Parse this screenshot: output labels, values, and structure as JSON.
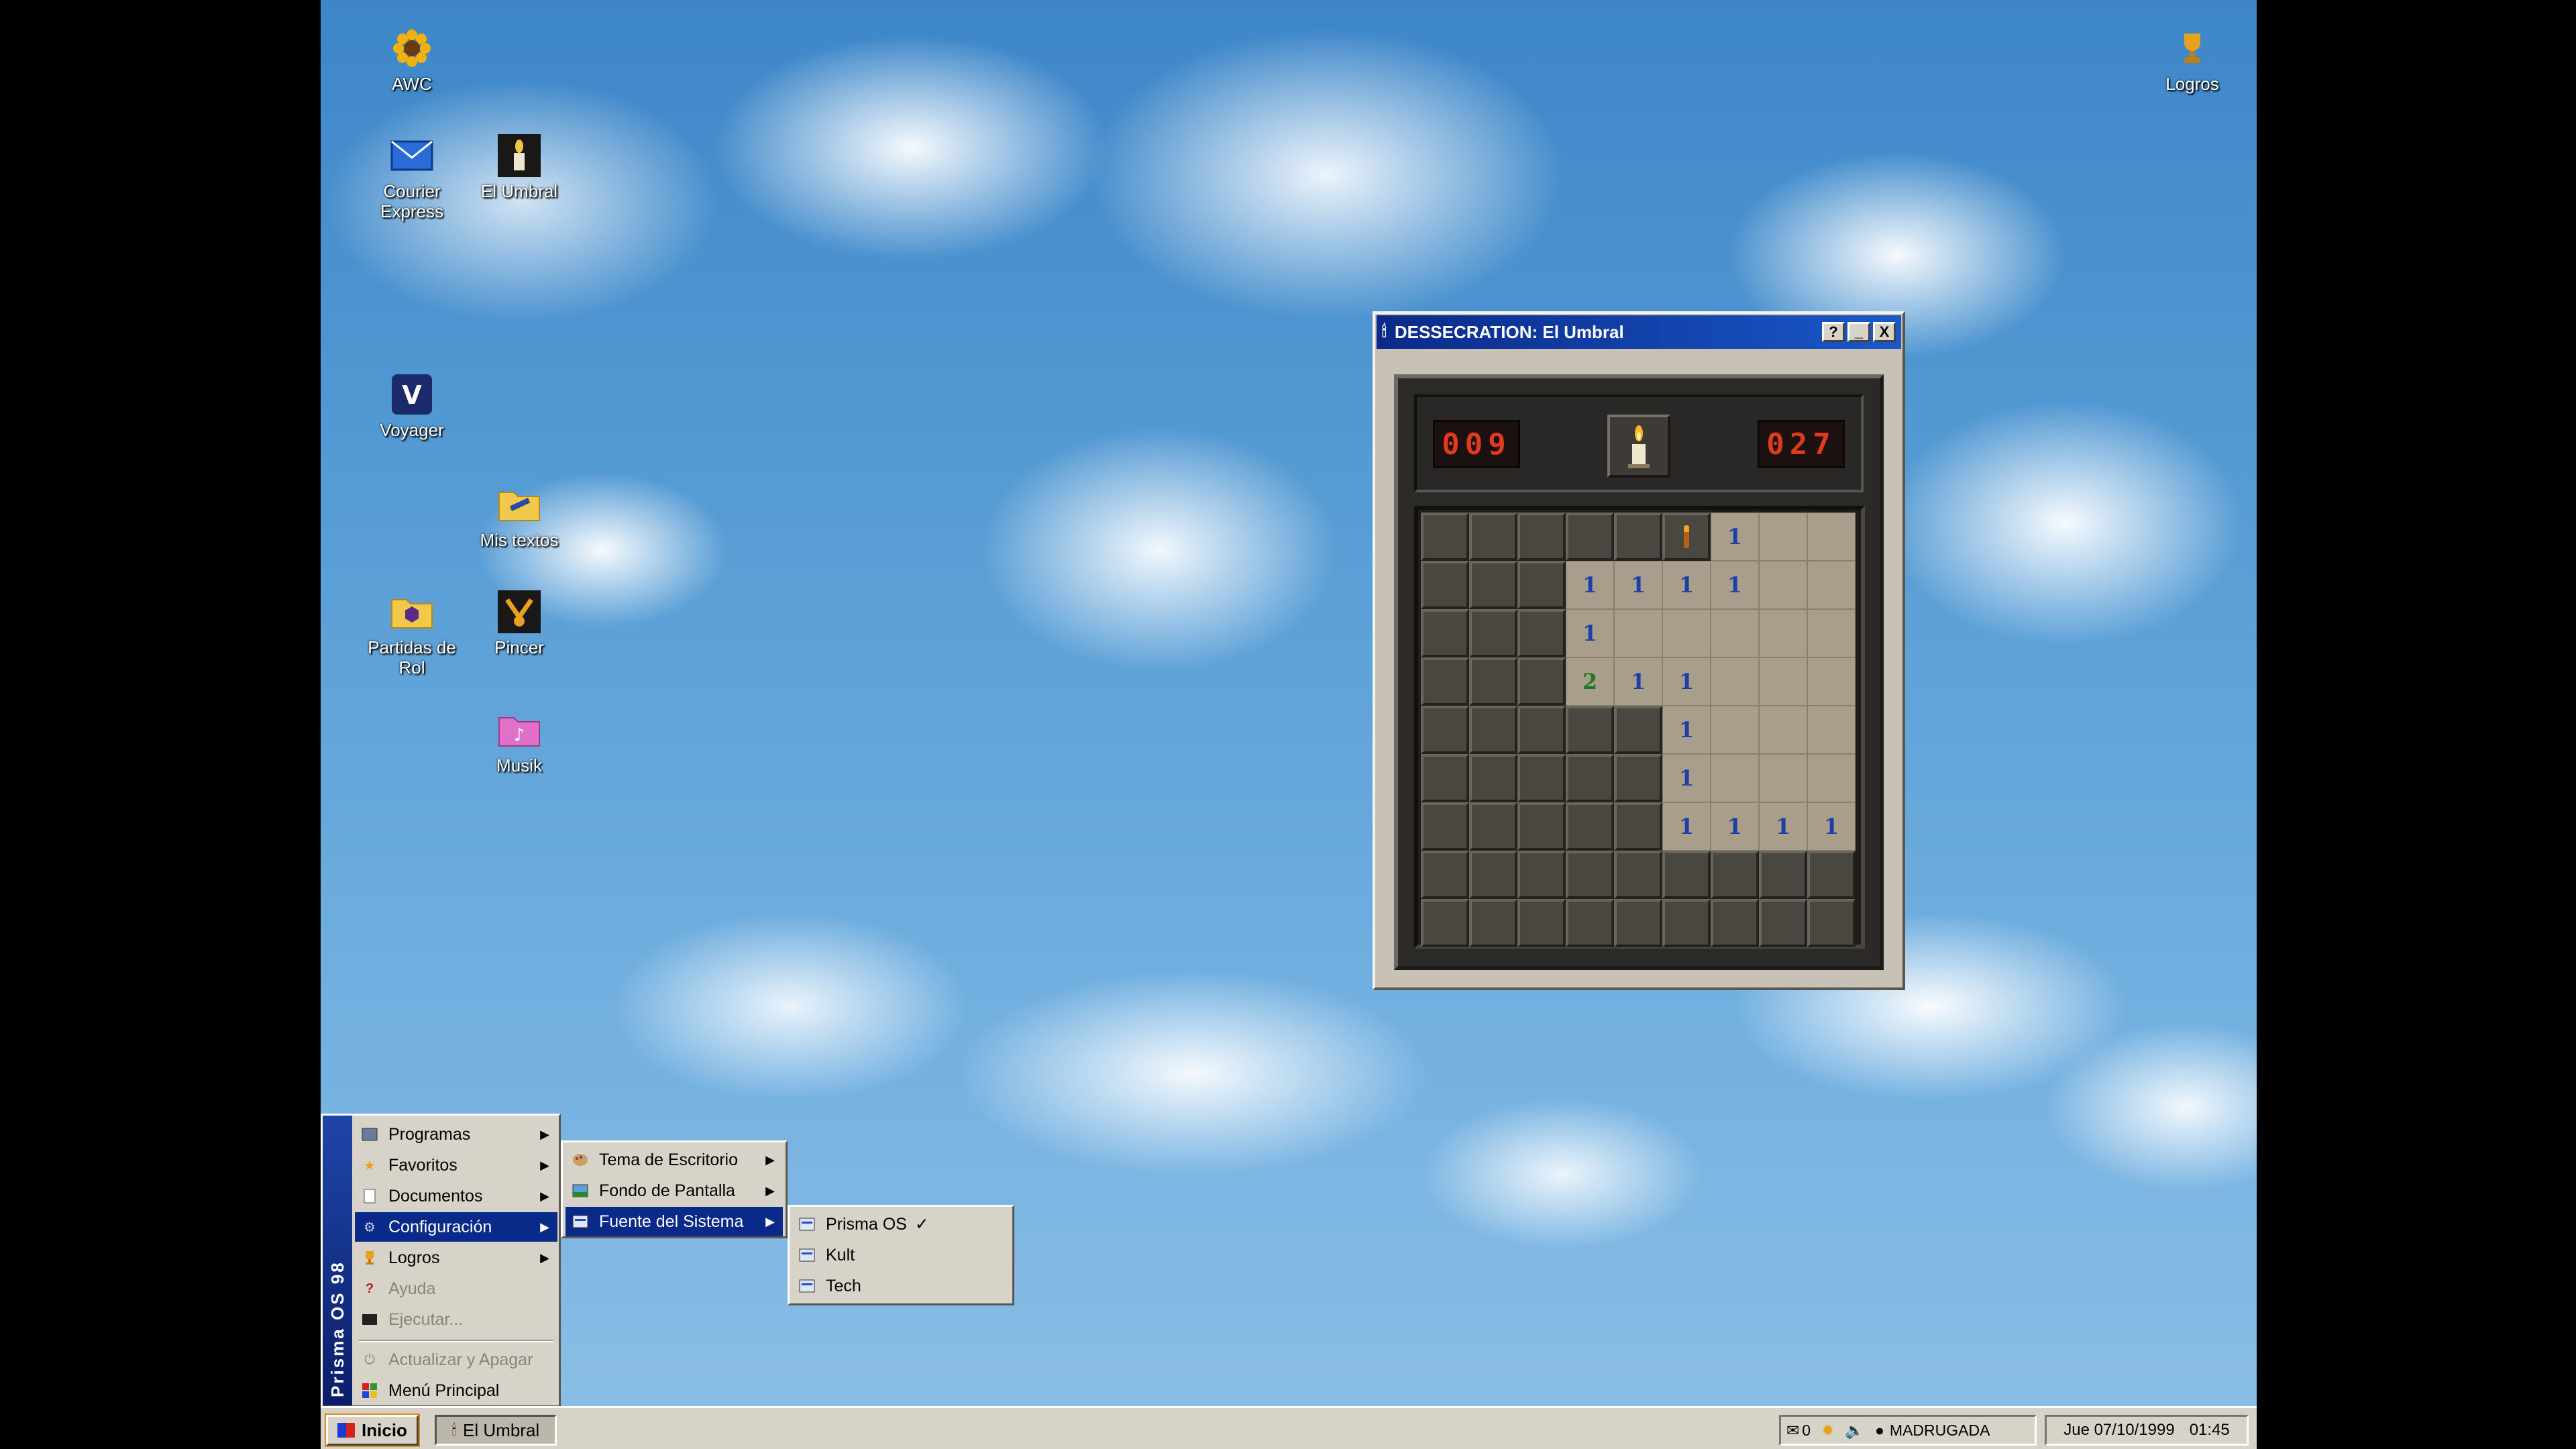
{
  "desktop": {
    "icons": [
      {
        "label": "AWC"
      },
      {
        "label": "Courier Express"
      },
      {
        "label": "El Umbral"
      },
      {
        "label": "Voyager"
      },
      {
        "label": "Mis textos"
      },
      {
        "label": "Partidas de Rol"
      },
      {
        "label": "Pincer"
      },
      {
        "label": "Musik"
      },
      {
        "label": "Logros"
      }
    ]
  },
  "window": {
    "title": "DESSECRATION: El Umbral",
    "buttons": {
      "help": "?",
      "minimize": "_",
      "close": "X"
    },
    "mine_counter": "009",
    "timer": "027",
    "board": [
      [
        "h",
        "h",
        "h",
        "h",
        "h",
        "flag",
        "1",
        "o",
        "o"
      ],
      [
        "h",
        "h",
        "h",
        "1",
        "1",
        "1",
        "1",
        "o",
        "o"
      ],
      [
        "h",
        "h",
        "h",
        "1",
        "o",
        "o",
        "o",
        "o",
        "o"
      ],
      [
        "h",
        "h",
        "h",
        "2",
        "1",
        "1",
        "o",
        "o",
        "o"
      ],
      [
        "h",
        "h",
        "h",
        "h",
        "h",
        "1",
        "o",
        "o",
        "o"
      ],
      [
        "h",
        "h",
        "h",
        "h",
        "h",
        "1",
        "o",
        "o",
        "o"
      ],
      [
        "h",
        "h",
        "h",
        "h",
        "h",
        "1",
        "1",
        "1",
        "1"
      ],
      [
        "h",
        "h",
        "h",
        "h",
        "h",
        "h",
        "h",
        "h",
        "h"
      ],
      [
        "h",
        "h",
        "h",
        "h",
        "h",
        "h",
        "h",
        "h",
        "h"
      ]
    ]
  },
  "start_menu": {
    "side_label": "Prisma OS 98",
    "items": [
      {
        "label": "Programas",
        "icon": "programs-icon"
      },
      {
        "label": "Favoritos",
        "icon": "star-icon"
      },
      {
        "label": "Documentos",
        "icon": "documents-icon"
      },
      {
        "label": "Configuración",
        "icon": "gear-icon"
      },
      {
        "label": "Logros",
        "icon": "trophy-icon"
      },
      {
        "label": "Ayuda",
        "icon": "help-icon"
      },
      {
        "label": "Ejecutar...",
        "icon": "run-icon"
      },
      {
        "label": "Actualizar y Apagar",
        "icon": "power-icon"
      },
      {
        "label": "Menú Principal",
        "icon": "main-menu-icon"
      }
    ],
    "config_submenu": [
      {
        "label": "Tema de Escritorio"
      },
      {
        "label": "Fondo de Pantalla"
      },
      {
        "label": "Fuente del Sistema"
      }
    ],
    "font_submenu": [
      {
        "label": "Prisma OS",
        "check": "✓"
      },
      {
        "label": "Kult"
      },
      {
        "label": "Tech"
      }
    ]
  },
  "taskbar": {
    "start_label": "Inicio",
    "task_label": "El Umbral",
    "mail_count": "0",
    "period": "MADRUGADA",
    "date": "Jue 07/10/1999",
    "time": "01:45"
  },
  "colors": {
    "title_bar": "#0a2a8a",
    "lcd_text": "#e23a1c",
    "number_one": "#1c3fa8",
    "number_two": "#1e7a22"
  }
}
